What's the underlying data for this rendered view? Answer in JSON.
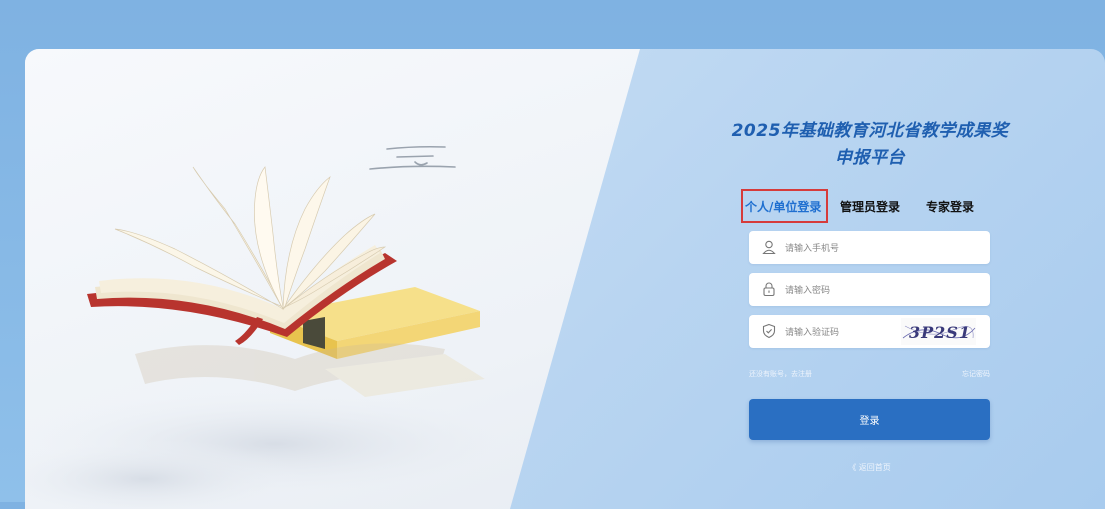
{
  "login": {
    "title_line1": "2025年基础教育河北省教学成果奖",
    "title_line2": "申报平台",
    "tabs": [
      {
        "label": "个人/单位登录",
        "active": true
      },
      {
        "label": "管理员登录",
        "active": false
      },
      {
        "label": "专家登录",
        "active": false
      }
    ],
    "phone": {
      "placeholder": "请输入手机号",
      "value": "",
      "icon": "user-icon"
    },
    "password": {
      "placeholder": "请输入密码",
      "value": "",
      "icon": "lock-icon"
    },
    "captcha": {
      "placeholder": "请输入验证码",
      "value": "",
      "icon": "shield-icon",
      "image_text": "3P2S1"
    },
    "register_link": "还没有账号，去注册",
    "forgot_link": "忘记密码",
    "login_button": "登录",
    "back_link": "《 返回首页"
  },
  "colors": {
    "background": "#7fb2e2",
    "accent": "#2a6fc2",
    "title": "#1f5fb0",
    "active_tab": "#1f6fd0",
    "highlight_box": "#d63b3b"
  }
}
